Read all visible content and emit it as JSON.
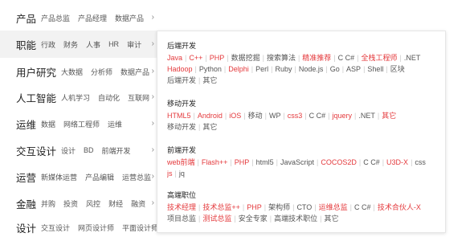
{
  "sidebar": {
    "categories": [
      {
        "label": "产品",
        "subs": [
          "产品总监",
          "产品经理",
          "数据产品"
        ],
        "active": false
      },
      {
        "label": "职能",
        "subs": [
          "行政",
          "财务",
          "人事",
          "HR",
          "审计"
        ],
        "active": true
      },
      {
        "label": "用户研究",
        "subs": [
          "大数据",
          "分析师",
          "数据产品"
        ],
        "active": false
      },
      {
        "label": "人工智能",
        "subs": [
          "人机学习",
          "自动化",
          "互联网"
        ],
        "active": false
      },
      {
        "label": "运维",
        "subs": [
          "数据",
          "网络工程师",
          "运维"
        ],
        "active": false
      },
      {
        "label": "交互设计",
        "subs": [
          "设计",
          "BD",
          "前端开发"
        ],
        "active": false
      },
      {
        "label": "运营",
        "subs": [
          "新媒体运营",
          "产品编辑",
          "运营总监"
        ],
        "active": false
      },
      {
        "label": "金融",
        "subs": [
          "并购",
          "投资",
          "风控",
          "财经",
          "融资"
        ],
        "active": false
      },
      {
        "label": "设计",
        "subs": [
          "交互设计",
          "网页设计师",
          "平面设计师"
        ],
        "active": false
      }
    ],
    "arrow": "›"
  },
  "panel": {
    "separator": "|",
    "sections": [
      {
        "title": "后端开发",
        "lines": [
          [
            {
              "t": "Java",
              "hot": true
            },
            {
              "t": "C++",
              "hot": true
            },
            {
              "t": "PHP",
              "hot": true
            },
            {
              "t": "数据挖掘",
              "hot": false
            },
            {
              "t": "搜索算法",
              "hot": false
            },
            {
              "t": "精准推荐",
              "hot": true
            },
            {
              "t": "C C#",
              "hot": false
            },
            {
              "t": "全栈工程师",
              "hot": true
            },
            {
              "t": ".NET",
              "hot": false
            }
          ],
          [
            {
              "t": "Hadoop",
              "hot": true
            },
            {
              "t": "Python",
              "hot": false
            },
            {
              "t": "Delphi",
              "hot": true
            },
            {
              "t": "Perl",
              "hot": false
            },
            {
              "t": "Ruby",
              "hot": false
            },
            {
              "t": "Node.js",
              "hot": false
            },
            {
              "t": "Go",
              "hot": false
            },
            {
              "t": "ASP",
              "hot": false
            },
            {
              "t": "Shell",
              "hot": false
            },
            {
              "t": "区块",
              "hot": false
            }
          ],
          [
            {
              "t": "后端开发",
              "hot": false
            },
            {
              "t": "其它",
              "hot": false
            }
          ]
        ]
      },
      {
        "title": "移动开发",
        "lines": [
          [
            {
              "t": "HTML5",
              "hot": true
            },
            {
              "t": "Android",
              "hot": true
            },
            {
              "t": "iOS",
              "hot": true
            },
            {
              "t": "移动",
              "hot": false
            },
            {
              "t": "WP",
              "hot": false
            },
            {
              "t": "css3",
              "hot": true
            },
            {
              "t": "C C#",
              "hot": false
            },
            {
              "t": "jquery",
              "hot": true
            },
            {
              "t": ".NET",
              "hot": false
            },
            {
              "t": "其它",
              "hot": true
            }
          ],
          [
            {
              "t": "移动开发",
              "hot": false
            },
            {
              "t": "其它",
              "hot": false
            }
          ]
        ]
      },
      {
        "title": "前端开发",
        "lines": [
          [
            {
              "t": "web前端",
              "hot": true
            },
            {
              "t": "Flash++",
              "hot": true
            },
            {
              "t": "PHP",
              "hot": true
            },
            {
              "t": "html5",
              "hot": false
            },
            {
              "t": "JavaScript",
              "hot": false
            },
            {
              "t": "COCOS2D",
              "hot": true
            },
            {
              "t": "C C#",
              "hot": false
            },
            {
              "t": "U3D-X",
              "hot": true
            },
            {
              "t": "css",
              "hot": false
            }
          ],
          [
            {
              "t": "js",
              "hot": true
            },
            {
              "t": "jq",
              "hot": false
            }
          ]
        ]
      },
      {
        "title": "高端职位",
        "lines": [
          [
            {
              "t": "技术经理",
              "hot": true
            },
            {
              "t": "技术总监++",
              "hot": true
            },
            {
              "t": "PHP",
              "hot": true
            },
            {
              "t": "架构师",
              "hot": false
            },
            {
              "t": "CTO",
              "hot": false
            },
            {
              "t": "运维总监",
              "hot": true
            },
            {
              "t": "C C#",
              "hot": false
            },
            {
              "t": "技术合伙人-X",
              "hot": true
            }
          ],
          [
            {
              "t": "项目总监",
              "hot": false
            },
            {
              "t": "测试总监",
              "hot": true
            },
            {
              "t": "安全专家",
              "hot": false
            },
            {
              "t": "高端技术职位",
              "hot": false
            },
            {
              "t": "其它",
              "hot": false
            }
          ]
        ]
      }
    ]
  }
}
